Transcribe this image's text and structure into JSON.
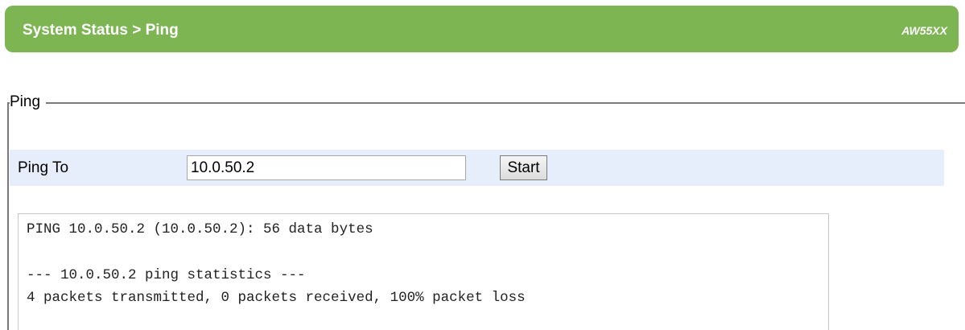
{
  "header": {
    "title": "System Status > Ping",
    "model": "AW55XX"
  },
  "ping_section": {
    "legend": "Ping",
    "ping_to_label": "Ping To",
    "ping_to_value": "10.0.50.2",
    "start_label": "Start"
  },
  "output": {
    "lines": [
      "PING 10.0.50.2 (10.0.50.2): 56 data bytes",
      "",
      "--- 10.0.50.2 ping statistics ---",
      "4 packets transmitted, 0 packets received, 100% packet loss"
    ]
  },
  "colors": {
    "header_bg": "#7cb552",
    "row_bg": "#e6eefb"
  }
}
